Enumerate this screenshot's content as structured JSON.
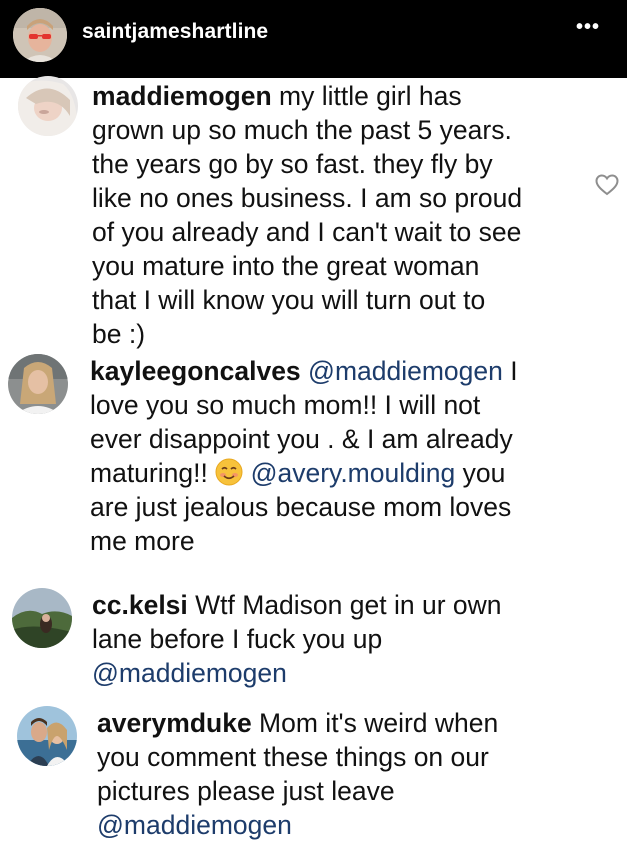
{
  "header": {
    "username": "saintjameshartline",
    "more_icon": "more-horizontal-icon",
    "more_label": "•••"
  },
  "comments": [
    {
      "username": "maddiemogen",
      "lines": [
        " my little girl has",
        "grown up so much the past 5 years.",
        "the years go by so fast. they fly by",
        "like no ones business. I am so proud",
        "of you already and I can't wait to see",
        "you mature into the great woman",
        "that I will know you will turn out to",
        "be :)"
      ]
    },
    {
      "username": "kayleegoncalves",
      "mention1": "@maddiemogen",
      "line1_tail": " I",
      "line2": "love you so much mom!! I will not",
      "line3": "ever disappoint you . & I am already",
      "line4_pre": "maturing!! ",
      "emoji": "smiling-face-with-smiling-eyes",
      "mention2": "@avery.moulding",
      "line4_tail": " you",
      "line5": "are just jealous because mom loves",
      "line6": "me more"
    },
    {
      "username": "cc.kelsi",
      "line1_tail": " Wtf Madison get in ur own",
      "line2": "lane before I fuck you up",
      "mention": "@maddiemogen"
    },
    {
      "username": "averymduke",
      "line1_tail": " Mom it's weird when",
      "line2": "you comment these things on our",
      "line3": "pictures please just leave",
      "mention": "@maddiemogen"
    }
  ],
  "colors": {
    "header_bg": "#000000",
    "panel_bg": "#ffffff",
    "text": "#111111",
    "mention": "#1d3c6b"
  }
}
